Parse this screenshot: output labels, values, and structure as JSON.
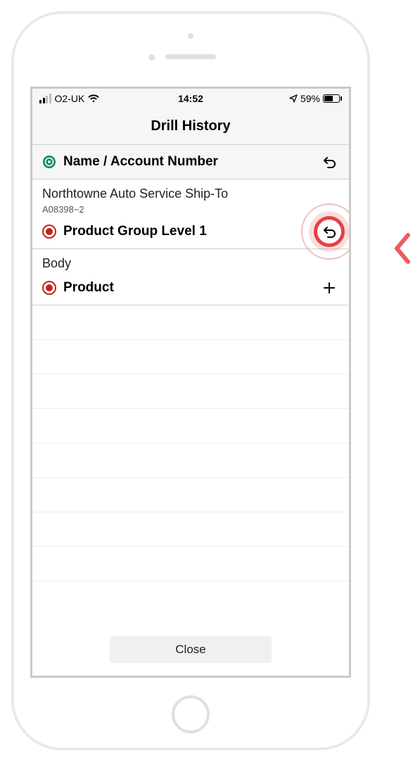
{
  "status": {
    "carrier": "O2-UK",
    "time": "14:52",
    "battery_pct": "59%"
  },
  "header": {
    "title": "Drill History"
  },
  "rows": [
    {
      "label": "Name / Account Number",
      "bullet_color_outer": "#0a8a5f",
      "bullet_color_inner": "#ffffff",
      "action": "undo"
    },
    {
      "upper": "Northtowne Auto Service Ship-To",
      "sub": "A08398~2",
      "label": "Product Group Level 1",
      "bullet_color_outer": "#c3231a",
      "bullet_color_inner": "#c3231a",
      "action": "undo",
      "highlighted": true
    },
    {
      "upper": "Body",
      "label": "Product",
      "bullet_color_outer": "#c3231a",
      "bullet_color_inner": "#c3231a",
      "action": "plus"
    }
  ],
  "footer": {
    "close_label": "Close"
  }
}
